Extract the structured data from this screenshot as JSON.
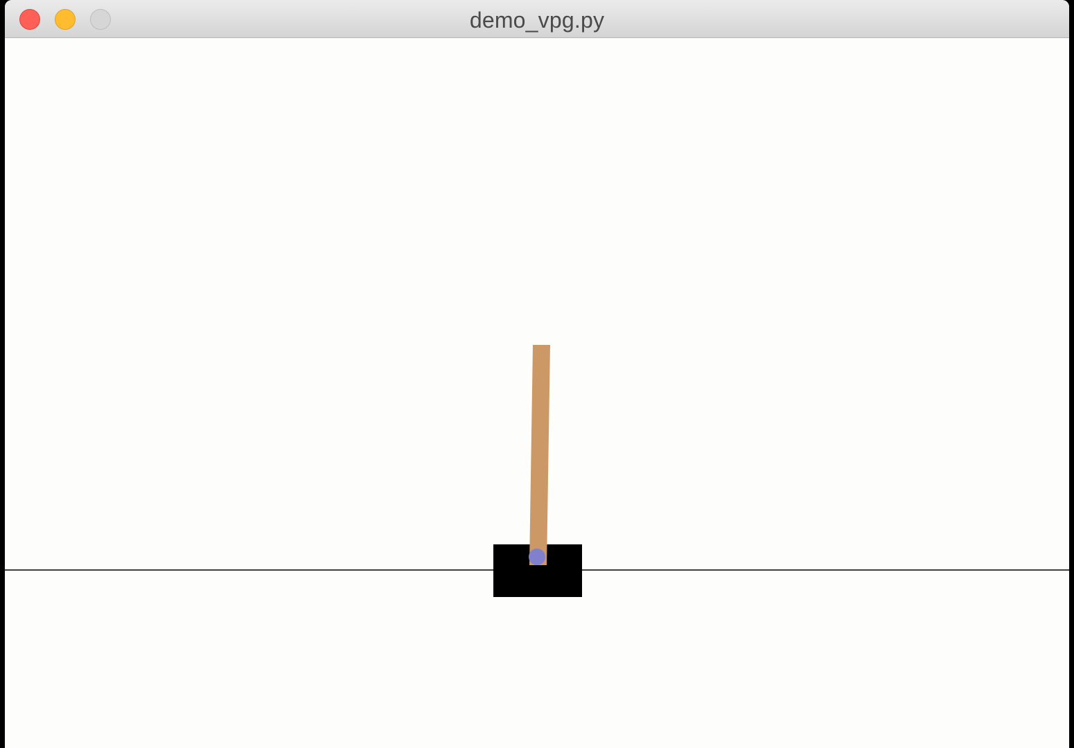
{
  "window": {
    "title": "demo_vpg.py",
    "controls": {
      "close": "close-button",
      "minimize": "minimize-button",
      "zoom": "zoom-button"
    }
  },
  "scene": {
    "environment": "cartpole",
    "colors": {
      "background": "#fdfdfb",
      "track": "#000000",
      "cart": "#000000",
      "pole": "#cc9966",
      "axle": "#8080cc"
    }
  }
}
